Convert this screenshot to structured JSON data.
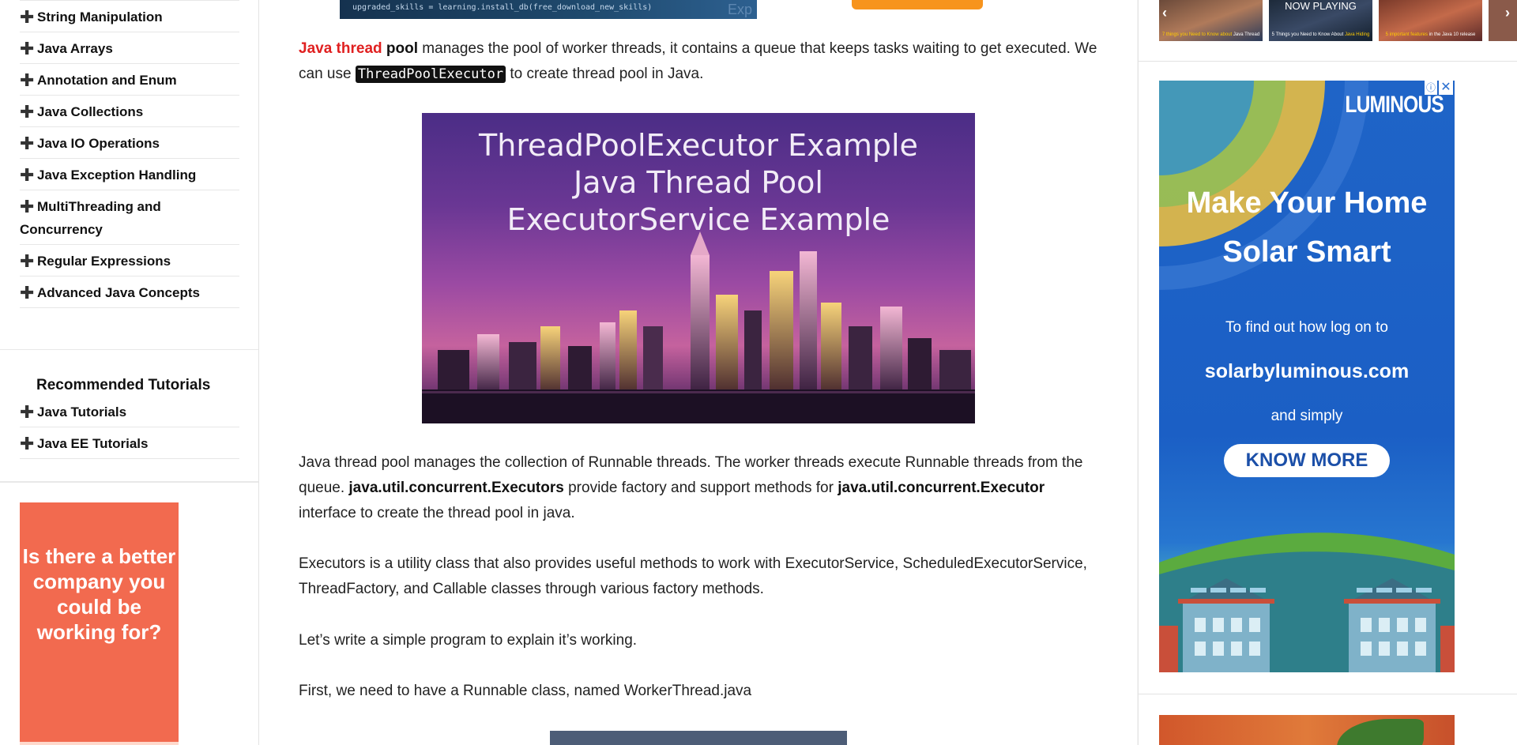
{
  "sidebar": {
    "menu_items": [
      {
        "label": "String Manipulation"
      },
      {
        "label": "Java Arrays"
      },
      {
        "label": "Annotation and Enum"
      },
      {
        "label": "Java Collections"
      },
      {
        "label": "Java IO Operations"
      },
      {
        "label": "Java Exception Handling"
      },
      {
        "label": "MultiThreading and Concurrency"
      },
      {
        "label": "Regular Expressions"
      },
      {
        "label": "Advanced Java Concepts"
      }
    ],
    "recommended": {
      "title": "Recommended Tutorials",
      "items": [
        {
          "label": "Java Tutorials"
        },
        {
          "label": "Java EE Tutorials"
        }
      ]
    },
    "ad": {
      "text": "Is there a better company you could be working for?",
      "background": "#f26a4f"
    }
  },
  "main": {
    "top_banner_text": "upgraded_skills = learning.install_db(free_download_new_skills)",
    "top_banner_tag": "Exp",
    "intro": {
      "link_text": "Java thread",
      "bold_word": "pool",
      "text_1": " manages the pool of worker threads, it contains a queue that keeps tasks waiting to get executed. We can use ",
      "code": "ThreadPoolExecutor",
      "text_2": " to create thread pool in Java."
    },
    "hero": {
      "line1": "ThreadPoolExecutor Example",
      "line2": "Java Thread Pool",
      "line3": "ExecutorService Example"
    },
    "para2": {
      "text_1": "Java thread pool manages the collection of Runnable threads. The worker threads execute Runnable threads from the queue. ",
      "bold_1": "java.util.concurrent.Executors",
      "text_2": " provide factory and support methods for ",
      "bold_2": "java.util.concurrent.Executor",
      "text_3": " interface to create the thread pool in java."
    },
    "para3": "Executors is a utility class that also provides useful methods to work with ExecutorService, ScheduledExecutorService, ThreadFactory, and Callable classes through various factory methods.",
    "para4": "Let’s write a simple program to explain it’s working.",
    "para5": "First, we need to have a Runnable class, named WorkerThread.java"
  },
  "rail": {
    "video": {
      "now_playing": "NOW PLAYING",
      "thumbs": [
        {
          "caption_pre": "",
          "caption_hl": "7 things you Need to Know about",
          "caption_post": "Java Thread"
        },
        {
          "caption_pre": "5 Things you Need to Know About",
          "caption_hl": "",
          "caption_post": "Java Hiding"
        },
        {
          "caption_pre": "",
          "caption_hl": "5 important features",
          "caption_post": "in the Java 10 release"
        }
      ],
      "prev_icon": "chevron-left-icon",
      "next_icon": "chevron-right-icon"
    },
    "ad": {
      "brand": "LUMINOUS",
      "headline_1": "Make Your Home",
      "headline_2": "Solar Smart",
      "sub_1": "To find out how log on to",
      "site": "solarbyluminous.com",
      "sub_2": "and simply",
      "cta": "KNOW MORE",
      "info_icon": "info-icon",
      "close_icon": "close-icon"
    }
  }
}
